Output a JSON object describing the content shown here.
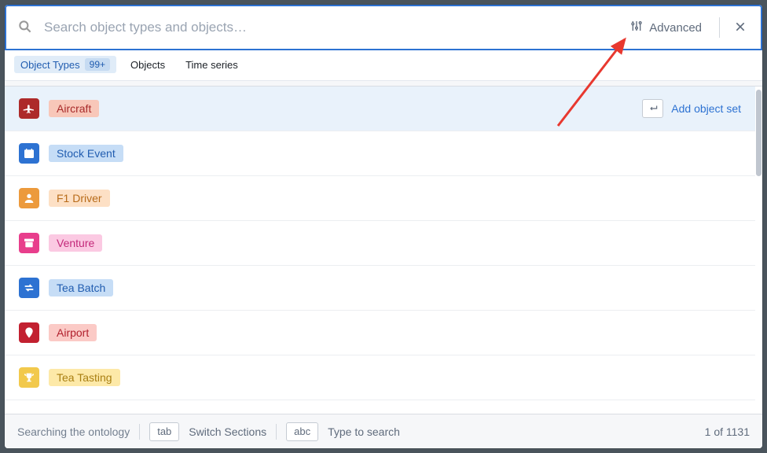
{
  "search": {
    "placeholder": "Search object types and objects…",
    "advanced_label": "Advanced"
  },
  "tabs": {
    "object_types": {
      "label": "Object Types",
      "count": "99+"
    },
    "objects": {
      "label": "Objects"
    },
    "time_series": {
      "label": "Time series"
    }
  },
  "results": {
    "add_object_set_label": "Add object set",
    "items": [
      {
        "label": "Aircraft",
        "icon": "plane",
        "icon_class": "ic-red",
        "chip_class": "chip-red"
      },
      {
        "label": "Stock Event",
        "icon": "calendar",
        "icon_class": "ic-blue",
        "chip_class": "chip-blue"
      },
      {
        "label": "F1 Driver",
        "icon": "person",
        "icon_class": "ic-orange",
        "chip_class": "chip-orange"
      },
      {
        "label": "Venture",
        "icon": "archive",
        "icon_class": "ic-pink",
        "chip_class": "chip-pink"
      },
      {
        "label": "Tea Batch",
        "icon": "arrows",
        "icon_class": "ic-blue",
        "chip_class": "chip-blue"
      },
      {
        "label": "Airport",
        "icon": "map-pin",
        "icon_class": "ic-crimson",
        "chip_class": "chip-crimson"
      },
      {
        "label": "Tea Tasting",
        "icon": "trophy",
        "icon_class": "ic-gold",
        "chip_class": "chip-gold"
      }
    ]
  },
  "footer": {
    "status": "Searching the ontology",
    "tab_key": "tab",
    "tab_hint": "Switch Sections",
    "abc_key": "abc",
    "abc_hint": "Type to search",
    "counter": "1 of 1131"
  }
}
